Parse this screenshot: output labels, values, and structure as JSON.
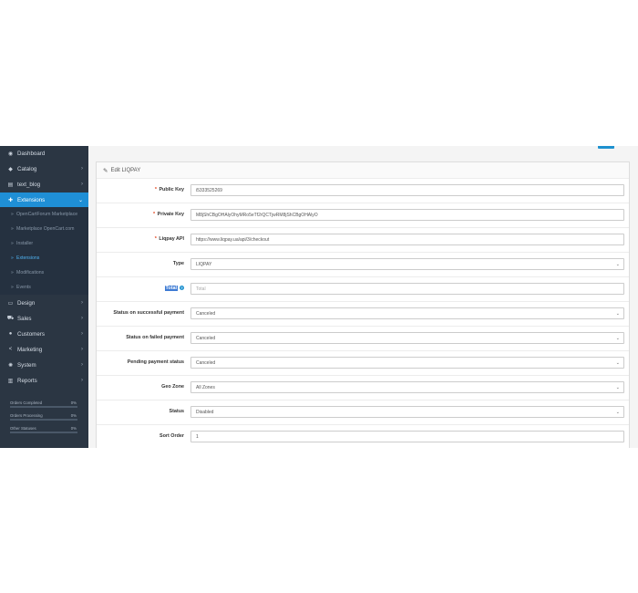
{
  "sidebar": {
    "items": [
      {
        "label": "Dashboard",
        "icon": "dashboard-icon",
        "glyph": "◉",
        "has_children": false
      },
      {
        "label": "Catalog",
        "icon": "tag-icon",
        "glyph": "◆",
        "has_children": true
      },
      {
        "label": "text_blog",
        "icon": "book-icon",
        "glyph": "▤",
        "has_children": true
      },
      {
        "label": "Extensions",
        "icon": "puzzle-icon",
        "glyph": "✚",
        "has_children": true,
        "active": true
      }
    ],
    "sub_items": [
      {
        "label": "OpenCartForum Marketplace"
      },
      {
        "label": "Marketplace OpenCart.com"
      },
      {
        "label": "Installer"
      },
      {
        "label": "Extensions",
        "current": true
      },
      {
        "label": "Modifications"
      },
      {
        "label": "Events"
      }
    ],
    "items_after": [
      {
        "label": "Design",
        "icon": "monitor-icon",
        "glyph": "▭",
        "has_children": true
      },
      {
        "label": "Sales",
        "icon": "cart-icon",
        "glyph": "⛟",
        "has_children": true
      },
      {
        "label": "Customers",
        "icon": "user-icon",
        "glyph": "●",
        "has_children": true
      },
      {
        "label": "Marketing",
        "icon": "share-icon",
        "glyph": "<",
        "has_children": true
      },
      {
        "label": "System",
        "icon": "cog-icon",
        "glyph": "✺",
        "has_children": true
      },
      {
        "label": "Reports",
        "icon": "bar-chart-icon",
        "glyph": "▥",
        "has_children": true
      }
    ],
    "stats": [
      {
        "label": "Orders Completed",
        "value": "0%",
        "fraction": 0
      },
      {
        "label": "Orders Processing",
        "value": "0%",
        "fraction": 0
      },
      {
        "label": "Other Statuses",
        "value": "0%",
        "fraction": 0
      }
    ]
  },
  "panel": {
    "title": "Edit LIQPAY"
  },
  "form": {
    "public_key": {
      "label": "Public Key",
      "value": "i5333525269"
    },
    "private_key": {
      "label": "Private Key",
      "value": "M8jShCBgOHAlyOhyMRo5eTf2rQCTjwRM8jShCBgOHAlyO"
    },
    "liqpay_api": {
      "label": "Liqpay API",
      "value": "https://www.liqpay.ua/api/3/checkout"
    },
    "type": {
      "label": "Type",
      "value": "LIQPAY"
    },
    "total": {
      "label": "Total",
      "placeholder": "Total"
    },
    "status_success": {
      "label": "Status on successful payment",
      "value": "Canceled"
    },
    "status_failed": {
      "label": "Status on failed payment",
      "value": "Canceled"
    },
    "pending_status": {
      "label": "Pending payment status",
      "value": "Canceled"
    },
    "geo_zone": {
      "label": "Geo Zone",
      "value": "All Zones"
    },
    "status": {
      "label": "Status",
      "value": "Disabled"
    },
    "sort_order": {
      "label": "Sort Order",
      "value": "1"
    }
  },
  "colors": {
    "accent": "#1e91cf",
    "sidebar_bg": "#2b3643",
    "required": "#e3421a"
  }
}
